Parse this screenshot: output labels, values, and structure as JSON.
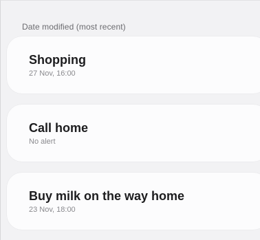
{
  "list": {
    "sort_label": "Date modified (most recent)",
    "items": [
      {
        "title": "Shopping",
        "subtitle": "27 Nov, 16:00"
      },
      {
        "title": "Call home",
        "subtitle": "No alert"
      },
      {
        "title": "Buy milk on the way home",
        "subtitle": "23 Nov, 18:00"
      }
    ]
  }
}
